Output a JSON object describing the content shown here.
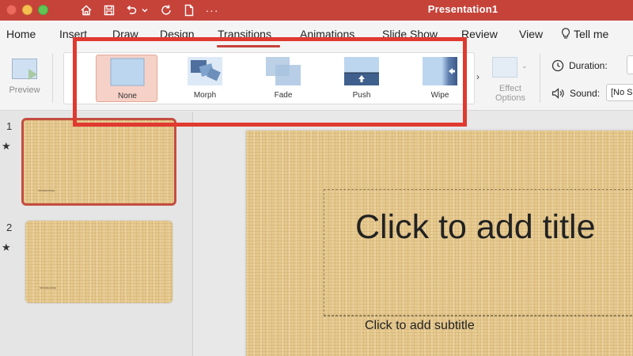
{
  "window": {
    "title": "Presentation1"
  },
  "quick_access": {
    "icons": [
      "home-icon",
      "save-icon",
      "undo-icon",
      "chevron-down-icon",
      "redo-icon",
      "new-file-icon",
      "more-icon"
    ],
    "more_label": "···"
  },
  "tabs": [
    {
      "label": "Home"
    },
    {
      "label": "Insert"
    },
    {
      "label": "Draw"
    },
    {
      "label": "Design"
    },
    {
      "label": "Transitions",
      "active": true
    },
    {
      "label": "Animations"
    },
    {
      "label": "Slide Show"
    },
    {
      "label": "Review"
    },
    {
      "label": "View"
    },
    {
      "label": "Tell me"
    }
  ],
  "ribbon": {
    "preview_label": "Preview",
    "transitions": [
      {
        "label": "None",
        "selected": true
      },
      {
        "label": "Morph"
      },
      {
        "label": "Fade"
      },
      {
        "label": "Push"
      },
      {
        "label": "Wipe"
      }
    ],
    "more_chevron": "›",
    "effect_options": {
      "line1": "Effect",
      "line2": "Options",
      "chevron": "⌄"
    },
    "duration_label": "Duration:",
    "sound_label": "Sound:",
    "sound_value": "[No Sound]"
  },
  "slides_panel": {
    "slides": [
      {
        "number": "1",
        "star": "★",
        "tiny_text": "Introductory"
      },
      {
        "number": "2",
        "star": "★",
        "tiny_text": "Introductory"
      }
    ]
  },
  "slide": {
    "title_placeholder": "Click to add title",
    "subtitle_placeholder": "Click to add subtitle"
  },
  "colors": {
    "accent": "#c6433a",
    "highlight": "#e0392f",
    "selected_transition": "#f6d1c7"
  }
}
